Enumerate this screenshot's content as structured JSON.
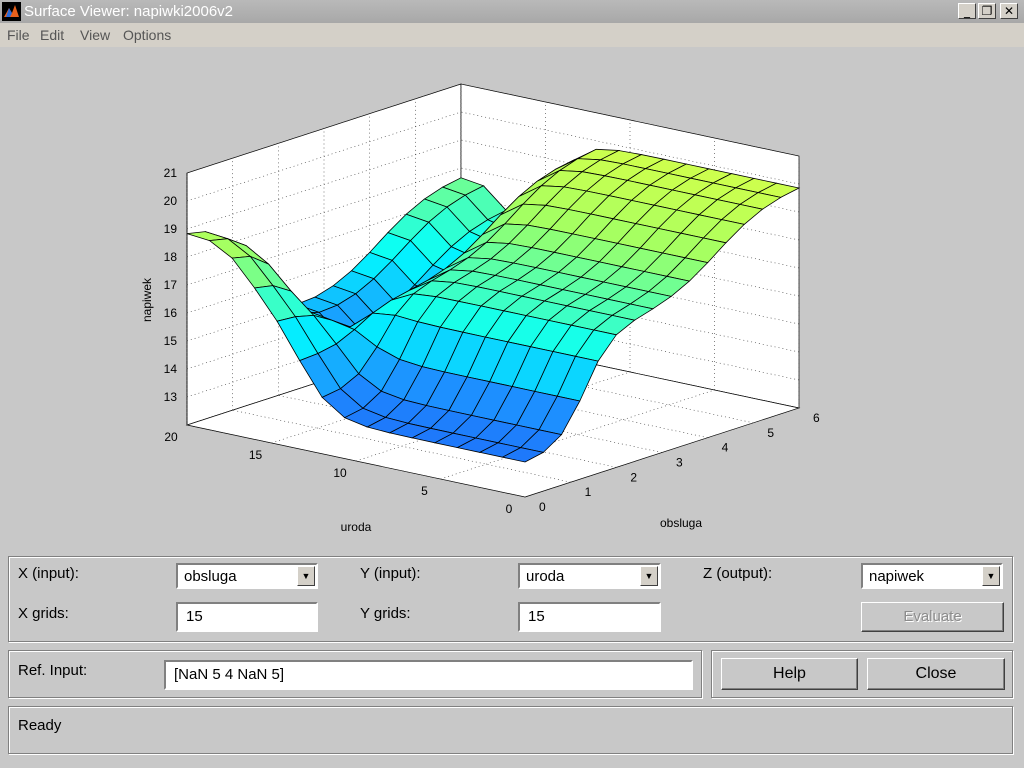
{
  "window": {
    "title": "Surface Viewer: napiwki2006v2"
  },
  "menu": [
    "File",
    "Edit",
    "View",
    "Options"
  ],
  "chart_data": {
    "type": "surface",
    "xlabel": "obsluga",
    "ylabel": "uroda",
    "zlabel": "napiwek",
    "xlim": [
      0,
      6
    ],
    "ylim": [
      0,
      20
    ],
    "zlim": [
      12,
      21
    ],
    "xticks": [
      0,
      1,
      2,
      3,
      4,
      5,
      6
    ],
    "yticks": [
      0,
      5,
      10,
      15,
      20
    ],
    "zticks": [
      13,
      14,
      15,
      16,
      17,
      18,
      19,
      20,
      21
    ],
    "grid": true,
    "colormap": [
      "#1f5ff5",
      "#00ffff",
      "#a8ff60",
      "#f0ff40"
    ]
  },
  "controls": {
    "x_input_label": "X (input):",
    "x_input_value": "obsluga",
    "y_input_label": "Y (input):",
    "y_input_value": "uroda",
    "z_output_label": "Z (output):",
    "z_output_value": "napiwek",
    "x_grids_label": "X grids:",
    "x_grids_value": "15",
    "y_grids_label": "Y grids:",
    "y_grids_value": "15",
    "evaluate_label": "Evaluate",
    "ref_input_label": "Ref. Input:",
    "ref_input_value": "[NaN 5 4 NaN 5]",
    "help_label": "Help",
    "close_label": "Close",
    "status": "Ready"
  }
}
